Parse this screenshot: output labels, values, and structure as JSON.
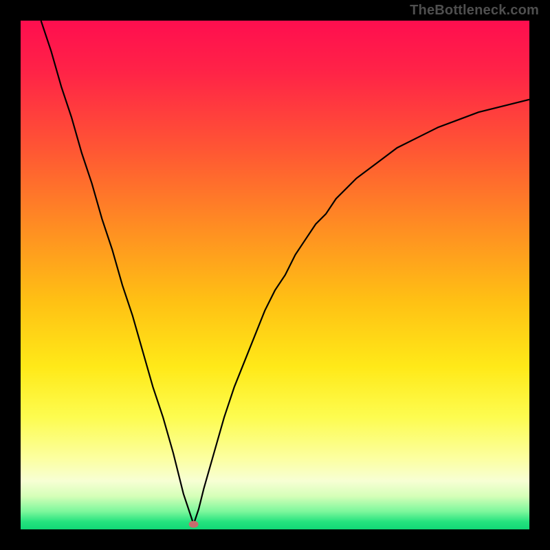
{
  "watermark": "TheBottleneck.com",
  "colors": {
    "background": "#000000",
    "curve": "#000000",
    "marker": "#c86d6d",
    "gradient_stops": [
      {
        "offset": 0.0,
        "color": "#ff0e4f"
      },
      {
        "offset": 0.1,
        "color": "#ff2347"
      },
      {
        "offset": 0.25,
        "color": "#ff5534"
      },
      {
        "offset": 0.4,
        "color": "#ff8b23"
      },
      {
        "offset": 0.55,
        "color": "#ffc014"
      },
      {
        "offset": 0.68,
        "color": "#ffe918"
      },
      {
        "offset": 0.78,
        "color": "#fdfc50"
      },
      {
        "offset": 0.86,
        "color": "#fcffa0"
      },
      {
        "offset": 0.905,
        "color": "#f7ffd4"
      },
      {
        "offset": 0.935,
        "color": "#d5ffb8"
      },
      {
        "offset": 0.965,
        "color": "#7cf79c"
      },
      {
        "offset": 0.985,
        "color": "#25e37e"
      },
      {
        "offset": 1.0,
        "color": "#12d876"
      }
    ]
  },
  "chart_data": {
    "type": "line",
    "title": "",
    "xlabel": "",
    "ylabel": "",
    "xlim": [
      0,
      100
    ],
    "ylim": [
      0,
      100
    ],
    "grid": false,
    "legend": false,
    "marker": {
      "x": 34,
      "y": 1
    },
    "series": [
      {
        "name": "curve",
        "x": [
          4,
          6,
          8,
          10,
          12,
          14,
          16,
          18,
          20,
          22,
          24,
          26,
          28,
          30,
          32,
          33,
          34,
          35,
          36,
          38,
          40,
          42,
          44,
          46,
          48,
          50,
          52,
          54,
          56,
          58,
          60,
          62,
          66,
          70,
          74,
          78,
          82,
          86,
          90,
          94,
          98,
          100
        ],
        "y": [
          100,
          94,
          87,
          81,
          74,
          68,
          61,
          55,
          48,
          42,
          35,
          28,
          22,
          15,
          7,
          4,
          1,
          4,
          8,
          15,
          22,
          28,
          33,
          38,
          43,
          47,
          50,
          54,
          57,
          60,
          62,
          65,
          69,
          72,
          75,
          77,
          79,
          80.5,
          82,
          83,
          84,
          84.5
        ]
      }
    ]
  }
}
